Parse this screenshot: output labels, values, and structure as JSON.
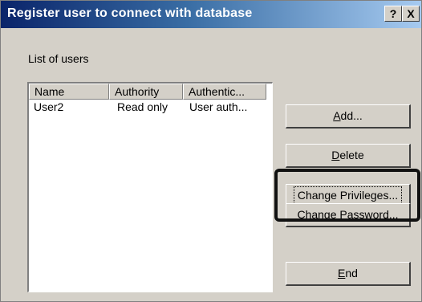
{
  "window": {
    "title": "Register user to connect with database",
    "help_label": "?",
    "close_label": "X"
  },
  "list": {
    "caption": "List of users",
    "columns": [
      "Name",
      "Authority",
      "Authentic..."
    ],
    "rows": [
      {
        "name": "User2",
        "authority": "Read only",
        "authentication": "User auth..."
      }
    ]
  },
  "buttons": {
    "add": {
      "prefix": "",
      "accel": "A",
      "suffix": "dd..."
    },
    "delete": {
      "prefix": "",
      "accel": "D",
      "suffix": "elete"
    },
    "change_privileges": {
      "label": "Change Privileges..."
    },
    "change_password": {
      "prefix": "Change ",
      "accel": "P",
      "suffix": "assword..."
    },
    "end": {
      "prefix": "",
      "accel": "E",
      "suffix": "nd"
    }
  }
}
